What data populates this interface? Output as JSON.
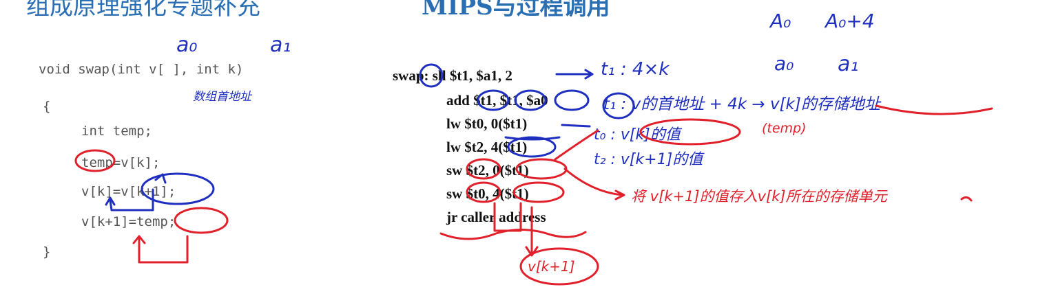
{
  "headings": {
    "left": "组成原理强化专题补充",
    "right": "MIPS与过程调用"
  },
  "c_code": {
    "lines": [
      "void swap(int v[ ], int k)",
      "{",
      "int temp;",
      "temp=v[k];",
      "v[k]=v[k+1];",
      "v[k+1]=temp;",
      "}"
    ]
  },
  "mips_code": {
    "lines": [
      "swap: sll $t1, $a1, 2",
      "add $t1, $t1, $a0",
      "lw $t0, 0($t1)",
      "lw $t2, 4($t1)",
      "sw $t2, 0($t1)",
      "sw $t0, 4($t1)",
      "jr caller address"
    ]
  },
  "annotations": {
    "a0_param": "a₀",
    "a1_param": "a₁",
    "array_base_note": "数组首地址",
    "t1_shift": "t₁ : 4×k",
    "t1_addr": "t₁ : v的首地址 + 4k → v[k]的存储地址",
    "t0_val": "t₀ : v[k]的值",
    "temp_note": "(temp)",
    "t2_val": "t₂ : v[k+1]的值",
    "store_note": "将 v[k+1]的值存入v[k]所在的存储单元",
    "addr_a0": "A₀",
    "addr_a0_plus4": "A₀+4",
    "reg_a0": "a₀",
    "reg_a1": "a₁",
    "vk1_label": "v[k+1]"
  },
  "colors": {
    "heading": "#2a6fb4",
    "annotation_blue": "#1f2fbf",
    "annotation_red": "#e0202a"
  }
}
